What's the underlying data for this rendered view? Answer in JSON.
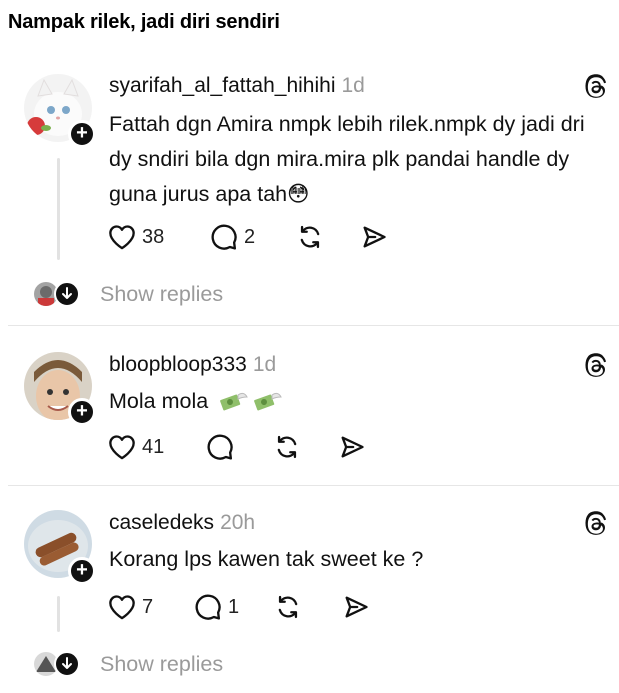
{
  "page": {
    "title": "Nampak rilek, jadi diri sendiri"
  },
  "comments": [
    {
      "username": "syarifah_al_fattah_hihihi",
      "time": "1d",
      "text": "Fattah dgn Amira nmpk lebih rilek.nmpk dy jadi dri dy sndiri bila dgn mira.mira plk pandai handle dy guna jurus apa tah",
      "emoji": "😳",
      "likes": "38",
      "replies": "2",
      "show_replies": "Show replies"
    },
    {
      "username": "bloopbloop333",
      "time": "1d",
      "text": "Mola mola",
      "emoji": "💸💸",
      "likes": "41",
      "replies": ""
    },
    {
      "username": "caseledeks",
      "time": "20h",
      "text": "Korang lps kawen tak sweet ke ?",
      "likes": "7",
      "replies": "1",
      "show_replies": "Show replies"
    }
  ],
  "icons": {
    "like": "heart-icon",
    "reply": "comment-icon",
    "repost": "repost-icon",
    "share": "send-icon",
    "platform": "threads-icon",
    "follow": "plus-icon",
    "expand": "arrow-down-icon"
  },
  "colors": {
    "text": "#111111",
    "muted": "#9a9a9a",
    "divider": "#e6e6e6"
  }
}
